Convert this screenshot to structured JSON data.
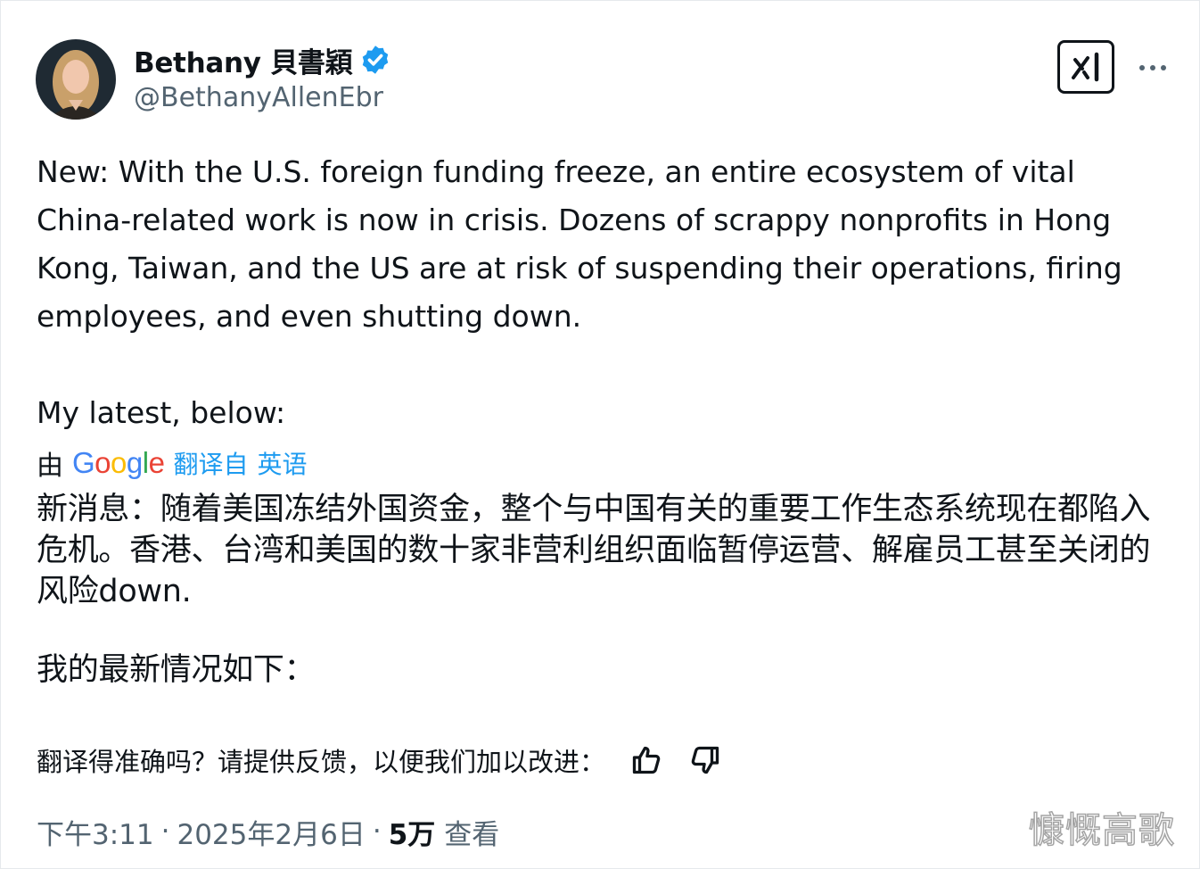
{
  "author": {
    "name": "Bethany 貝書穎",
    "handle": "@BethanyAllenEbr",
    "verified": true,
    "verified_color": "#1d9bf0"
  },
  "header_actions": {
    "grok_icon": "grok-icon",
    "more_icon": "more-horizontal-icon"
  },
  "tweet": {
    "paragraphs": [
      "New: With the U.S. foreign funding freeze, an entire ecosystem of vital China-related work is now in crisis. Dozens of scrappy nonprofits in Hong Kong, Taiwan, and the US are at risk of suspending their operations, firing employees, and even shutting down.",
      "My latest, below:"
    ]
  },
  "translation": {
    "prefix": "由",
    "provider": "Google",
    "translated_from": "翻译自",
    "language": "英语",
    "paragraphs": [
      "新消息：随着美国冻结外国资金，整个与中国有关的重要工作生态系统现在都陷入危机。香港、台湾和美国的数十家非营利组织面临暂停运营、解雇员工甚至关闭的风险down.",
      "我的最新情况如下："
    ]
  },
  "feedback": {
    "prompt": "翻译得准确吗？请提供反馈，以便我们加以改进：",
    "thumbs_up_icon": "thumbs-up-icon",
    "thumbs_down_icon": "thumbs-down-icon"
  },
  "meta": {
    "time": "下午3:11",
    "separator": "·",
    "date": "2025年2月6日",
    "views_count": "5万",
    "views_label": "查看"
  },
  "watermark": "慷慨高歌",
  "colors": {
    "text": "#0f1419",
    "secondary": "#536471",
    "accent": "#1d9bf0"
  }
}
